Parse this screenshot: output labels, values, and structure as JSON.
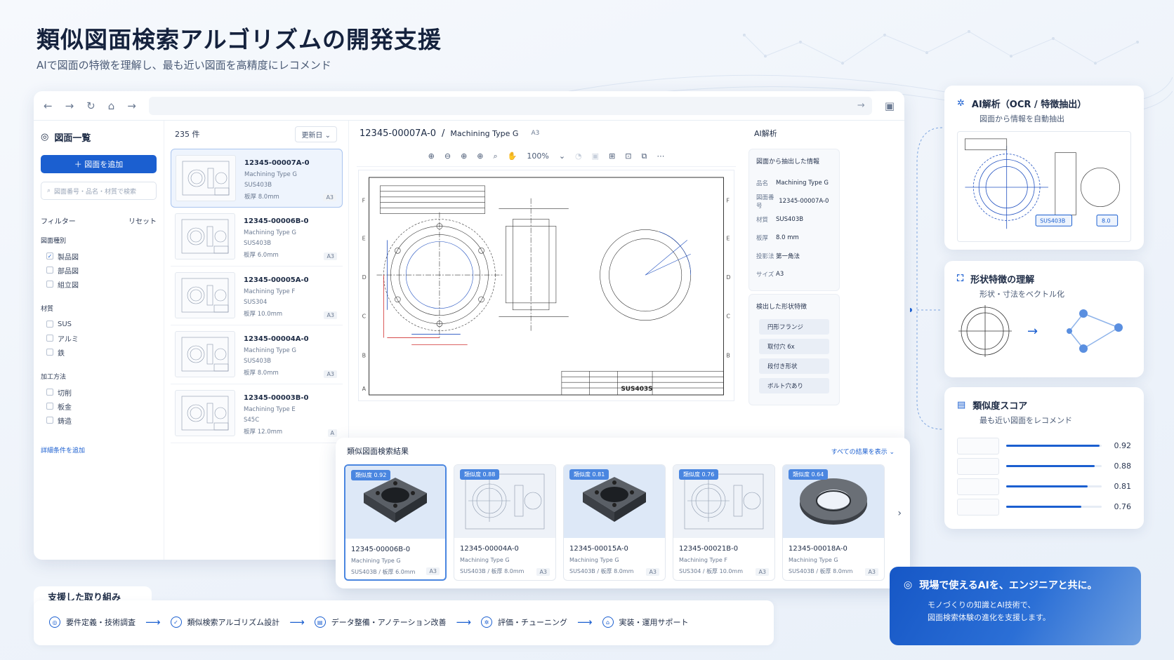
{
  "header": {
    "title": "類似図面検索アルゴリズムの開発支援",
    "subtitle": "AIで図面の特徴を理解し、最も近い図面を高精度にレコメンド"
  },
  "sidebar": {
    "title": "図面一覧",
    "add_button": "＋ 図面を追加",
    "search_placeholder": "図面番号・品名・材質で検索",
    "filter_label": "フィルター",
    "reset_label": "リセット",
    "groups": [
      {
        "label": "図面種別",
        "options": [
          {
            "label": "製品図",
            "checked": true
          },
          {
            "label": "部品図",
            "checked": false
          },
          {
            "label": "組立図",
            "checked": false
          }
        ]
      },
      {
        "label": "材質",
        "options": [
          {
            "label": "SUS",
            "checked": false
          },
          {
            "label": "アルミ",
            "checked": false
          },
          {
            "label": "鉄",
            "checked": false
          }
        ]
      },
      {
        "label": "加工方法",
        "options": [
          {
            "label": "切削",
            "checked": false
          },
          {
            "label": "板金",
            "checked": false
          },
          {
            "label": "鋳造",
            "checked": false
          }
        ]
      }
    ],
    "more_link": "詳細条件を追加"
  },
  "list": {
    "count": "235 件",
    "sort": "更新日",
    "items": [
      {
        "id": "12345-00007A-0",
        "name": "Machining Type G",
        "material": "SUS403B",
        "thickness": "板厚 8.0mm",
        "size": "A3"
      },
      {
        "id": "12345-00006B-0",
        "name": "Machining Type G",
        "material": "SUS403B",
        "thickness": "板厚 6.0mm",
        "size": "A3"
      },
      {
        "id": "12345-00005A-0",
        "name": "Machining Type F",
        "material": "SUS304",
        "thickness": "板厚 10.0mm",
        "size": "A3"
      },
      {
        "id": "12345-00004A-0",
        "name": "Machining Type G",
        "material": "SUS403B",
        "thickness": "板厚 8.0mm",
        "size": "A3"
      },
      {
        "id": "12345-00003B-0",
        "name": "Machining Type E",
        "material": "S45C",
        "thickness": "板厚 12.0mm",
        "size": "A"
      }
    ]
  },
  "viewer": {
    "drawing_id": "12345-00007A-0",
    "separator": "/",
    "drawing_name": "Machining Type G",
    "size": "A3",
    "zoom": "100%",
    "title_block_material": "SUS403S"
  },
  "ai_panel": {
    "title": "AI解析",
    "extracted_title": "図面から抽出した情報",
    "fields": [
      {
        "key": "品名",
        "value": "Machining Type G"
      },
      {
        "key": "図面番号",
        "value": "12345-00007A-0"
      },
      {
        "key": "材質",
        "value": "SUS403B"
      },
      {
        "key": "板厚",
        "value": "8.0 mm"
      },
      {
        "key": "投影法",
        "value": "第一角法"
      },
      {
        "key": "サイズ",
        "value": "A3"
      }
    ],
    "features_title": "検出した形状特徴",
    "features": [
      "円形フランジ",
      "取付穴 6x",
      "段付き形状",
      "ボルト穴あり"
    ]
  },
  "results": {
    "title": "類似図面検索結果",
    "show_all": "すべての結果を表示",
    "items": [
      {
        "score": "類似度 0.92",
        "id": "12345-00006B-0",
        "name": "Machining Type G",
        "spec": "SUS403B / 板厚 6.0mm",
        "size": "A3",
        "kind": "3d-square"
      },
      {
        "score": "類似度 0.88",
        "id": "12345-00004A-0",
        "name": "Machining Type G",
        "spec": "SUS403B / 板厚 8.0mm",
        "size": "A3",
        "kind": "drawing"
      },
      {
        "score": "類似度 0.81",
        "id": "12345-00015A-0",
        "name": "Machining Type G",
        "spec": "SUS403B / 板厚 8.0mm",
        "size": "A3",
        "kind": "3d-square"
      },
      {
        "score": "類似度 0.76",
        "id": "12345-00021B-0",
        "name": "Machining Type F",
        "spec": "SUS304 / 板厚 10.0mm",
        "size": "A3",
        "kind": "drawing"
      },
      {
        "score": "類似度 0.64",
        "id": "12345-00018A-0",
        "name": "Machining Type G",
        "spec": "SUS403B / 板厚 8.0mm",
        "size": "A3",
        "kind": "3d-ring"
      }
    ]
  },
  "right_panels": {
    "analysis": {
      "title": "AI解析（OCR / 特徴抽出）",
      "desc": "図面から情報を自動抽出",
      "tag_material": "SUS403B",
      "tag_thickness": "8.0"
    },
    "shape": {
      "title": "形状特徴の理解",
      "desc": "形状・寸法をベクトル化"
    },
    "score": {
      "title": "類似度スコア",
      "desc": "最も近い図面をレコメンド",
      "scores": [
        0.92,
        0.88,
        0.81,
        0.76
      ],
      "labels": [
        "0.92",
        "0.88",
        "0.81",
        "0.76"
      ]
    }
  },
  "bottom": {
    "title": "支援した取り組み",
    "steps": [
      "要件定義・技術調査",
      "類似検索アルゴリズム設計",
      "データ整備・アノテーション改善",
      "評価・チューニング",
      "実装・運用サポート"
    ]
  },
  "cta": {
    "title": "現場で使えるAIを、エンジニアと共に。",
    "line1": "モノづくりの知識とAI技術で、",
    "line2": "図面検索体験の進化を支援します。"
  },
  "colors": {
    "accent": "#1b5fd0",
    "highlight": "#4a86e0",
    "text": "#1c2a44"
  }
}
